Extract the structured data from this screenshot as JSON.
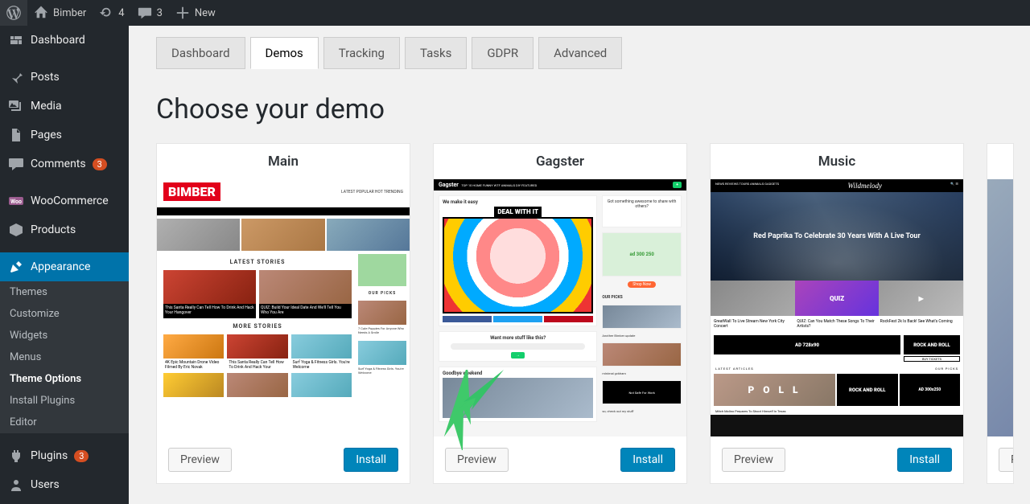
{
  "adminbar": {
    "site_name": "Bimber",
    "updates_count": "4",
    "comments_count": "3",
    "new_label": "New"
  },
  "sidebar": {
    "dashboard": "Dashboard",
    "posts": "Posts",
    "media": "Media",
    "pages": "Pages",
    "comments": "Comments",
    "comments_badge": "3",
    "woocommerce": "WooCommerce",
    "products": "Products",
    "appearance": "Appearance",
    "appearance_sub": {
      "themes": "Themes",
      "customize": "Customize",
      "widgets": "Widgets",
      "menus": "Menus",
      "theme_options": "Theme Options",
      "install_plugins": "Install Plugins",
      "editor": "Editor"
    },
    "plugins": "Plugins",
    "plugins_badge": "3",
    "users": "Users"
  },
  "tabs": {
    "dashboard": "Dashboard",
    "demos": "Demos",
    "tracking": "Tracking",
    "tasks": "Tasks",
    "gdpr": "GDPR",
    "advanced": "Advanced"
  },
  "page": {
    "title": "Choose your demo"
  },
  "demos": [
    {
      "title": "Main",
      "preview": "Preview",
      "install": "Install"
    },
    {
      "title": "Gagster",
      "preview": "Preview",
      "install": "Install"
    },
    {
      "title": "Music",
      "preview": "Preview",
      "install": "Install"
    },
    {
      "title": "",
      "preview": "P",
      "install": ""
    }
  ],
  "thumb": {
    "main": {
      "logo": "BIMBER",
      "tabs": "LATEST  POPULAR  HOT  TRENDING",
      "latest_stories": "LATEST STORIES",
      "more_stories": "MORE STORIES",
      "our_picks": "OUR PICKS",
      "cap1": "This Santa Really Can Tell How To Drink And Hack Your Hangover",
      "cap2": "QUIZ: Build Your Ideal Date And We'll Tell You Who You Are",
      "cap3": "7 Cute Puppies For Anyone Who Needs A Smile",
      "sm1": "4K Epic Mountain Drone Video Filmed By Eric Novak",
      "sm2": "This Santa Really Can Tell How To Drink And Hack Your Hangover",
      "sm3": "Surf Yoga & Fitness Girls. You're Welcome",
      "sm4": "Surf Yoga & Fitness Girls. You're Welcome"
    },
    "gagster": {
      "logo": "Gagster",
      "nav": "TOP 10  HOME  FUNNY  WTF  ANIMALS  DIY  FEATURED",
      "h1": "We make it easy",
      "deal": "DEAL WITH IT",
      "side1": "Got something awesome to share with others?",
      "side2": "ad 300 250",
      "h2": "Want more stuff like this?",
      "h3": "Goodbye weekend",
      "picks": "OUR PICKS",
      "s3": "Another Bimber update",
      "s4": "minimal gckham",
      "s5": "Not Safe For Work",
      "s6": "so, check out my stuff"
    },
    "music": {
      "logo": "Wildmelody",
      "nav": "NEWS  REVIEWS  TOURS  ANIMALS  GADGETS",
      "hero": "Red Paprika To Celebrate 30 Years With A Live Tour",
      "quiz": "QUIZ",
      "a1": "GreatWall To Live Stream New York City Concert",
      "a2": "QUIZ: Can You Match These Songs To Their Artists?",
      "a3": "RockFest 2k Is Back! See What's Coming",
      "ad": "AD 728x90",
      "rockroll": "ROCK AND ROLL",
      "buy": "BUY TICKETS",
      "latest": "LATEST ARTICLES",
      "picks": "OUR PICKS",
      "poll": "P O L L",
      "ad2": "AD 300x250",
      "p1": "Mitch Molino Prepares To Shoot Himself In Texas"
    }
  }
}
